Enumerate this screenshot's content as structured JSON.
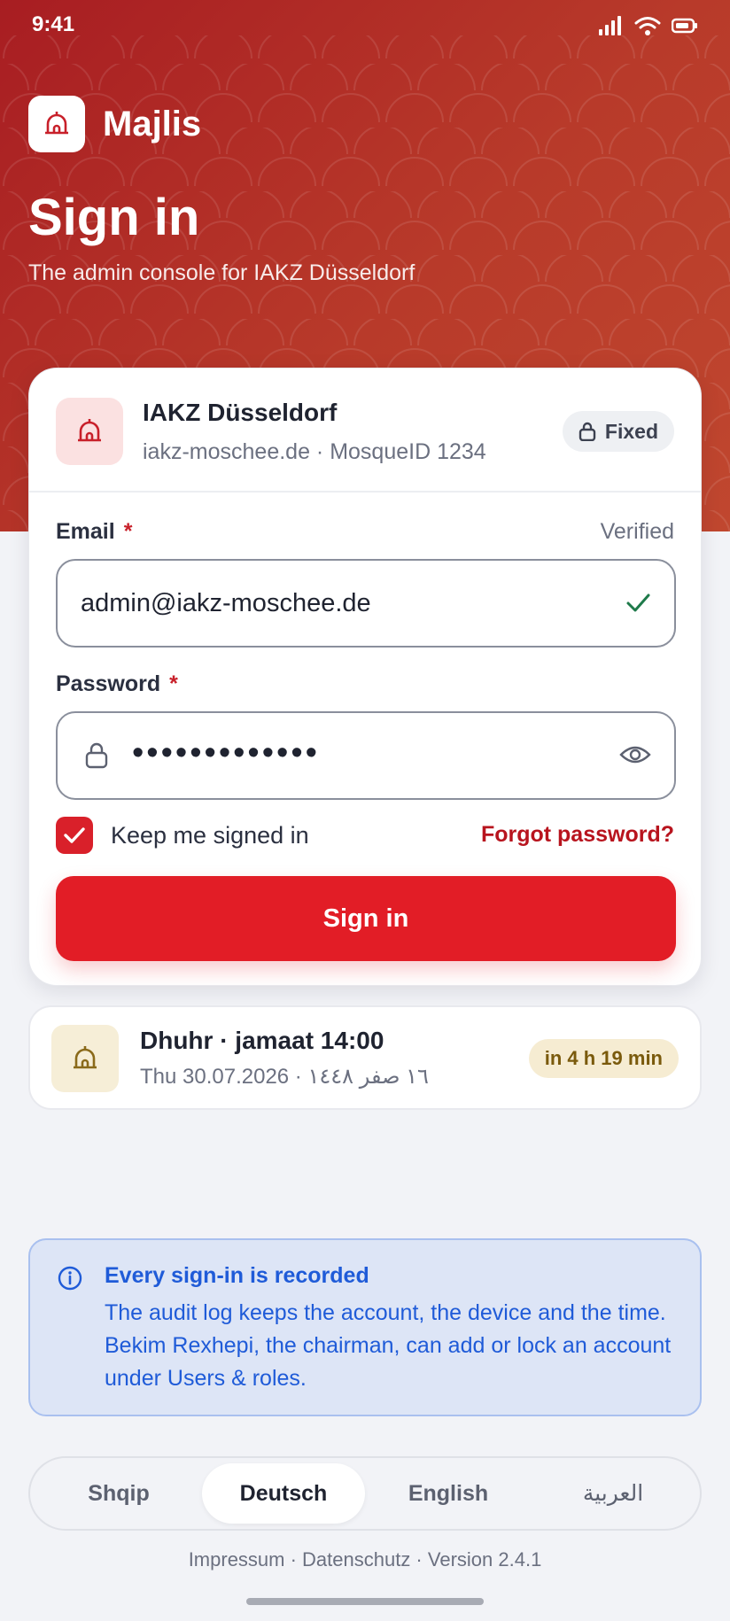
{
  "status_bar": {
    "time": "9:41"
  },
  "brand": {
    "name": "Majlis"
  },
  "hero": {
    "title": "Sign in",
    "subtitle": "The admin console for IAKZ Düsseldorf"
  },
  "organization": {
    "name": "IAKZ Düsseldorf",
    "meta": "iakz-moschee.de · MosqueID 1234",
    "badge": "Fixed"
  },
  "form": {
    "email_label": "Email",
    "email_required": "*",
    "email_status": "Verified",
    "email_value": "admin@iakz-moschee.de",
    "password_label": "Password",
    "password_required": "*",
    "password_mask": "•••••••••••••",
    "keep_signed_in_label": "Keep me signed in",
    "keep_signed_in": true,
    "forgot_label": "Forgot password?",
    "submit_label": "Sign in"
  },
  "prayer": {
    "title": "Dhuhr · jamaat 14:00",
    "date": "Thu 30.07.2026 · ١٦ صفر ١٤٤٨",
    "countdown": "in 4 h 19 min"
  },
  "notice": {
    "title": "Every sign-in is recorded",
    "body": "The audit log keeps the account, the device and the time. Bekim Rexhepi, the chairman, can add or lock an account under Users & roles."
  },
  "languages": {
    "options": [
      "Shqip",
      "Deutsch",
      "English",
      "العربية"
    ],
    "selected": "Deutsch"
  },
  "footer": {
    "links": "Impressum · Datenschutz · Version 2.4.1"
  },
  "colors": {
    "brand_red": "#e21d26",
    "hero_red": "#a81d22",
    "info_blue": "#1f5bd8",
    "success_green": "#1e7a4a"
  }
}
